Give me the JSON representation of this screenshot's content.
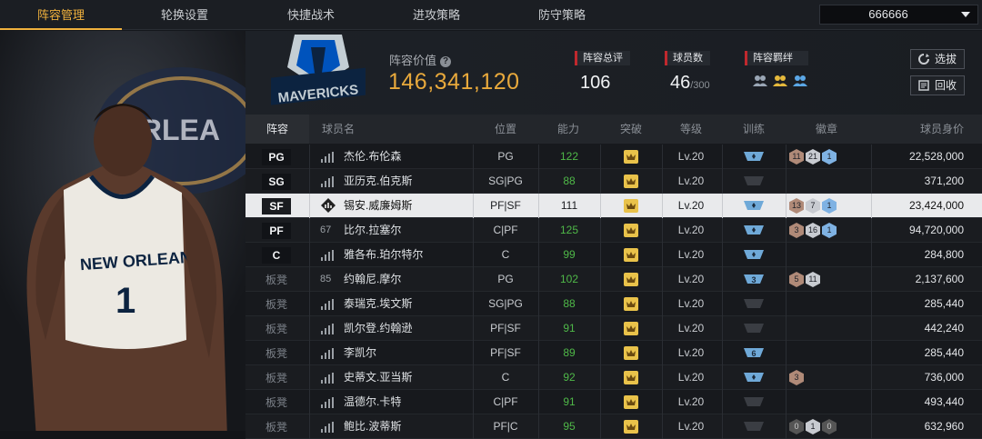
{
  "nav": {
    "tabs": [
      "阵容管理",
      "轮换设置",
      "快捷战术",
      "进攻策略",
      "防守策略"
    ],
    "active_tab": 0,
    "account_select": "666666"
  },
  "team": {
    "logo_text": "MAVERICKS",
    "value_label": "阵容价值",
    "value": "146,341,120",
    "overall_label": "阵容总评",
    "overall": "106",
    "player_count_label": "球员数",
    "player_count": "46",
    "player_count_max": "/300",
    "bond_label": "阵容羁绊",
    "select_button": "选拔",
    "recycle_button": "回收"
  },
  "player_art": {
    "jersey_team": "NEW ORLEANS",
    "jersey_number": "1",
    "backdrop_text": "ORLEA"
  },
  "table": {
    "headers": [
      "阵容",
      "球员名",
      "位置",
      "能力",
      "突破",
      "等级",
      "训练",
      "徽章",
      "球员身价"
    ],
    "rows": [
      {
        "slot": "PG",
        "bench": false,
        "rank": "",
        "name": "杰伦.布伦森",
        "position": "PG",
        "ability": "122",
        "ability_green": true,
        "level": "Lv.20",
        "train": "icon",
        "badges": [
          {
            "v": "11",
            "t": "b"
          },
          {
            "v": "21",
            "t": "s"
          },
          {
            "v": "1",
            "t": "g"
          }
        ],
        "price": "22,528,000"
      },
      {
        "slot": "SG",
        "bench": false,
        "rank": "",
        "name": "亚历克.伯克斯",
        "position": "SG|PG",
        "ability": "88",
        "ability_green": true,
        "level": "Lv.20",
        "train": "empty",
        "badges": [],
        "price": "371,200"
      },
      {
        "slot": "SF",
        "bench": false,
        "rank": "",
        "name": "锡安.威廉姆斯",
        "position": "PF|SF",
        "ability": "111",
        "ability_green": false,
        "level": "Lv.20",
        "train": "icon",
        "badges": [
          {
            "v": "13",
            "t": "b"
          },
          {
            "v": "7",
            "t": "s"
          },
          {
            "v": "1",
            "t": "g"
          }
        ],
        "price": "23,424,000",
        "selected": true
      },
      {
        "slot": "PF",
        "bench": false,
        "rank": "67",
        "name": "比尔.拉塞尔",
        "position": "C|PF",
        "ability": "125",
        "ability_green": true,
        "level": "Lv.20",
        "train": "icon",
        "badges": [
          {
            "v": "3",
            "t": "b"
          },
          {
            "v": "16",
            "t": "s"
          },
          {
            "v": "1",
            "t": "g"
          }
        ],
        "price": "94,720,000"
      },
      {
        "slot": "C",
        "bench": false,
        "rank": "",
        "name": "雅各布.珀尔特尔",
        "position": "C",
        "ability": "99",
        "ability_green": true,
        "level": "Lv.20",
        "train": "icon",
        "badges": [],
        "price": "284,800"
      },
      {
        "slot": "板凳",
        "bench": true,
        "rank": "85",
        "name": "约翰尼.摩尔",
        "position": "PG",
        "ability": "102",
        "ability_green": true,
        "level": "Lv.20",
        "train": "3",
        "badges": [
          {
            "v": "5",
            "t": "b"
          },
          {
            "v": "11",
            "t": "s"
          }
        ],
        "price": "2,137,600"
      },
      {
        "slot": "板凳",
        "bench": true,
        "rank": "",
        "name": "泰瑞克.埃文斯",
        "position": "SG|PG",
        "ability": "88",
        "ability_green": true,
        "level": "Lv.20",
        "train": "empty",
        "badges": [],
        "price": "285,440"
      },
      {
        "slot": "板凳",
        "bench": true,
        "rank": "",
        "name": "凯尔登.约翰逊",
        "position": "PF|SF",
        "ability": "91",
        "ability_green": true,
        "level": "Lv.20",
        "train": "empty",
        "badges": [],
        "price": "442,240"
      },
      {
        "slot": "板凳",
        "bench": true,
        "rank": "",
        "name": "李凯尔",
        "position": "PF|SF",
        "ability": "89",
        "ability_green": true,
        "level": "Lv.20",
        "train": "6",
        "badges": [],
        "price": "285,440"
      },
      {
        "slot": "板凳",
        "bench": true,
        "rank": "",
        "name": "史蒂文.亚当斯",
        "position": "C",
        "ability": "92",
        "ability_green": true,
        "level": "Lv.20",
        "train": "icon",
        "badges": [
          {
            "v": "3",
            "t": "b"
          }
        ],
        "price": "736,000"
      },
      {
        "slot": "板凳",
        "bench": true,
        "rank": "",
        "name": "温德尔.卡特",
        "position": "C|PF",
        "ability": "91",
        "ability_green": true,
        "level": "Lv.20",
        "train": "empty",
        "badges": [],
        "price": "493,440"
      },
      {
        "slot": "板凳",
        "bench": true,
        "rank": "",
        "name": "鲍比.波蒂斯",
        "position": "PF|C",
        "ability": "95",
        "ability_green": true,
        "level": "Lv.20",
        "train": "empty",
        "badges": [
          {
            "v": "0",
            "t": "d"
          },
          {
            "v": "1",
            "t": "s"
          },
          {
            "v": "0",
            "t": "d"
          }
        ],
        "price": "632,960"
      }
    ]
  }
}
